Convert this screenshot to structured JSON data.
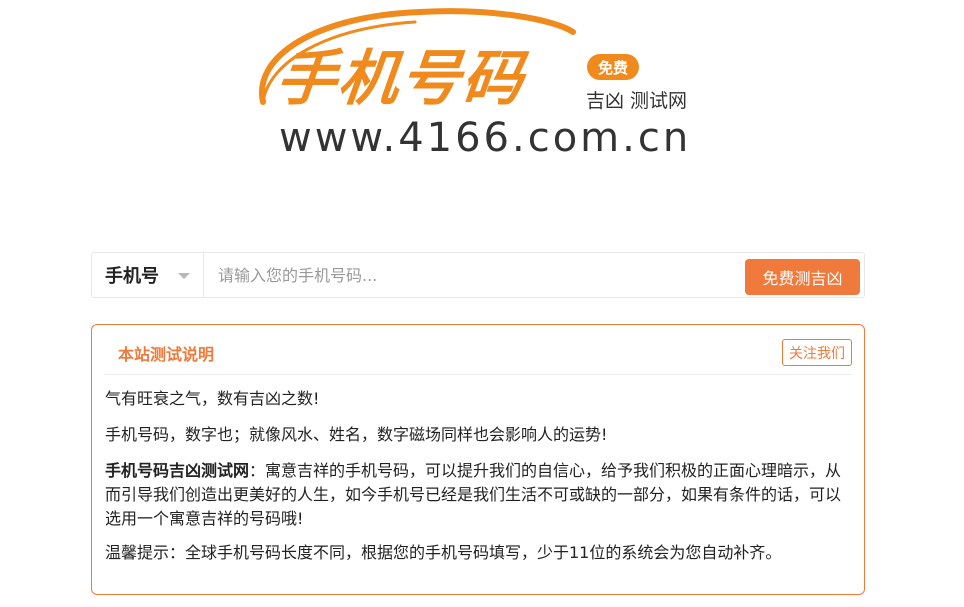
{
  "logo": {
    "title": "手机号码",
    "badge": "免费",
    "subtitle": "吉凶 测试网",
    "url": "www.4166.com.cn",
    "brand_color": "#f08a1c"
  },
  "search": {
    "type_label": "手机号",
    "placeholder": "请输入您的手机号码...",
    "value": "",
    "button_label": "免费测吉凶",
    "accent_color": "#ef7a3b"
  },
  "panel": {
    "title": "本站测试说明",
    "follow_label": "关注我们",
    "paragraph1": "气有旺衰之气，数有吉凶之数!",
    "paragraph2": "手机号码，数字也；就像风水、姓名，数字磁场同样也会影响人的运势!",
    "paragraph3_lead": "手机号码吉凶测试网",
    "paragraph3_rest": "：寓意吉祥的手机号码，可以提升我们的自信心，给予我们积极的正面心理暗示，从而引导我们创造出更美好的人生，如今手机号已经是我们生活不可或缺的一部分，如果有条件的话，可以选用一个寓意吉祥的号码哦!",
    "paragraph4": "温馨提示：全球手机号码长度不同，根据您的手机号码填写，少于11位的系统会为您自动补齐。"
  }
}
